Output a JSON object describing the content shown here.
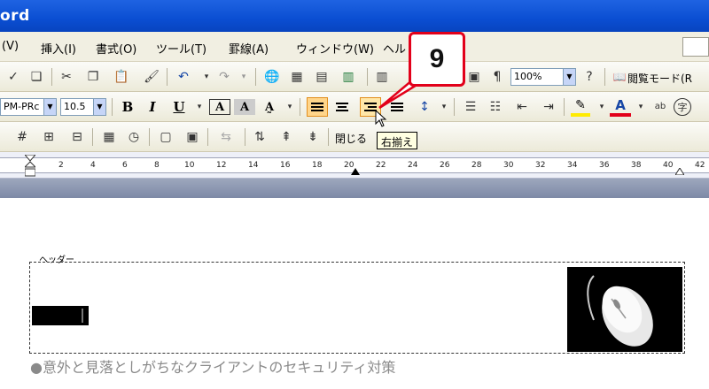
{
  "window": {
    "title": "ord"
  },
  "menu": {
    "items": [
      "(V)",
      "挿入(I)",
      "書式(O)",
      "ツール(T)",
      "罫線(A)",
      "ウィンドウ(W)",
      "ヘル"
    ]
  },
  "toolbar_standard": {
    "zoom_value": "100%",
    "reading_mode_label": "閲覧モード(R"
  },
  "toolbar_format": {
    "style_value": "PM-PRc",
    "font_size_value": "10.5",
    "bold_label": "B",
    "italic_label": "I",
    "underline_label": "U",
    "font_color_label": "A",
    "phonetic_label": "ab",
    "enclose_label": "字"
  },
  "toolbar_header": {
    "close_label": "閉じる"
  },
  "tooltip": {
    "text": "右揃え"
  },
  "callout": {
    "number": "9"
  },
  "ruler": {
    "ticks": [
      "2",
      "4",
      "6",
      "8",
      "10",
      "12",
      "14",
      "16",
      "18",
      "20",
      "22",
      "24",
      "26",
      "28",
      "30",
      "32",
      "34",
      "36",
      "38",
      "40",
      "42"
    ]
  },
  "document": {
    "header_label": "ヘッダー",
    "bottom_text": "●意外と見落としがちなクライアントのセキュリティ対策"
  },
  "colors": {
    "titlebar": "#0a4ed2",
    "callout_border": "#e2001a",
    "align_active": "#ffd58a",
    "tooltip_bg": "#ffffe1"
  }
}
